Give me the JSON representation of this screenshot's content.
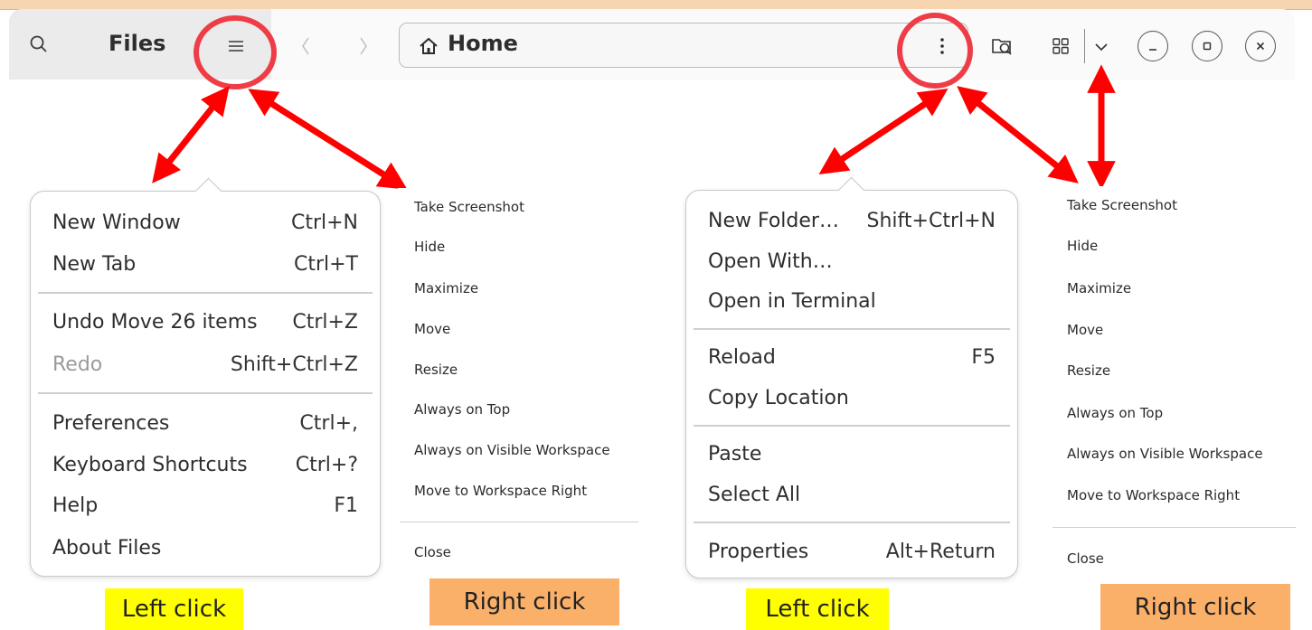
{
  "header": {
    "app_title": "Files",
    "location": "Home",
    "icons": [
      "search-icon",
      "hamburger-menu-icon",
      "back-chevron-icon",
      "forward-chevron-icon",
      "home-icon",
      "kebab-menu-icon",
      "search-folder-icon",
      "grid-view-icon",
      "chevron-down-icon",
      "minimize-icon",
      "maximize-icon",
      "close-icon"
    ]
  },
  "left_main_menu": {
    "sections": [
      [
        {
          "label": "New Window",
          "accel": "Ctrl+N"
        },
        {
          "label": "New Tab",
          "accel": "Ctrl+T"
        }
      ],
      [
        {
          "label": "Undo Move 26 items",
          "accel": "Ctrl+Z"
        },
        {
          "label": "Redo",
          "accel": "Shift+Ctrl+Z",
          "disabled": true
        }
      ],
      [
        {
          "label": "Preferences",
          "accel": "Ctrl+,"
        },
        {
          "label": "Keyboard Shortcuts",
          "accel": "Ctrl+?"
        },
        {
          "label": "Help",
          "accel": "F1"
        },
        {
          "label": "About Files",
          "accel": ""
        }
      ]
    ]
  },
  "right_main_menu": {
    "sections": [
      [
        {
          "label": "New Folder…",
          "accel": "Shift+Ctrl+N"
        },
        {
          "label": "Open With…",
          "accel": ""
        },
        {
          "label": "Open in Terminal",
          "accel": ""
        }
      ],
      [
        {
          "label": "Reload",
          "accel": "F5"
        },
        {
          "label": "Copy Location",
          "accel": ""
        }
      ],
      [
        {
          "label": "Paste",
          "accel": ""
        },
        {
          "label": "Select All",
          "accel": ""
        }
      ],
      [
        {
          "label": "Properties",
          "accel": "Alt+Return"
        }
      ]
    ]
  },
  "window_context_menu": {
    "items": [
      "Take Screenshot",
      "Hide",
      "Maximize",
      "Move",
      "Resize",
      "Always on Top",
      "Always on Visible Workspace",
      "Move to Workspace Right"
    ],
    "close": "Close"
  },
  "captions": {
    "left_click": "Left click",
    "right_click": "Right click"
  },
  "colors": {
    "highlight_circle": "#ee3d46",
    "arrow": "#ff0000",
    "left_click_bg": "#ffff00",
    "right_click_bg": "#fbb06a"
  }
}
